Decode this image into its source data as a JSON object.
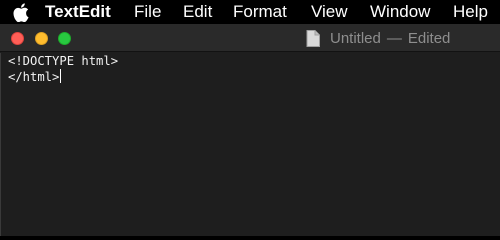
{
  "menubar": {
    "apple_icon": "apple-logo-icon",
    "app_name": "TextEdit",
    "items": [
      "File",
      "Edit",
      "Format",
      "View",
      "Window",
      "Help"
    ]
  },
  "window": {
    "title": "Untitled",
    "separator": "—",
    "status": "Edited",
    "document_icon": "document-icon",
    "traffic_lights": {
      "close": "#ff5f57",
      "minimize": "#febc2e",
      "zoom": "#28c840"
    }
  },
  "editor": {
    "lines": [
      "<!DOCTYPE html>",
      "</html>"
    ]
  },
  "colors": {
    "menubar_background": "#000000",
    "editor_background": "#1e1e1e",
    "titlebar_background": "#2a2a2a",
    "editor_text": "#f2f2f2",
    "title_text": "#8e8e8e"
  }
}
